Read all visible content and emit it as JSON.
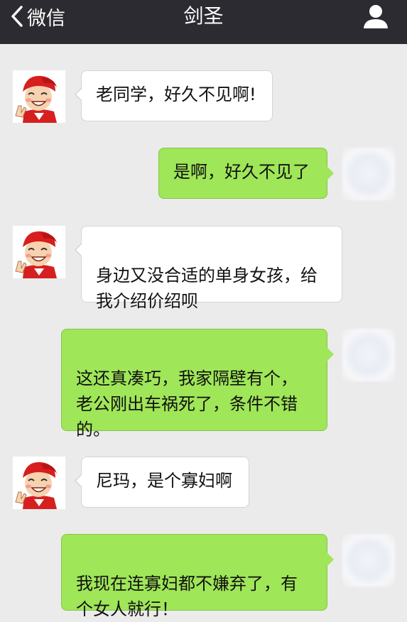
{
  "header": {
    "back_label": "微信",
    "title": "剑圣"
  },
  "messages": [
    {
      "side": "left",
      "text": "老同学，好久不见啊!"
    },
    {
      "side": "right",
      "text": "是啊，好久不见了"
    },
    {
      "side": "left",
      "text": "身边又没合适的单身女孩，给\n我介绍价绍呗"
    },
    {
      "side": "right",
      "text": "这还真凑巧，我家隔壁有个，\n老公刚出车祸死了，条件不错\n的。"
    },
    {
      "side": "left",
      "text": "尼玛，是个寡妇啊"
    },
    {
      "side": "right",
      "text": "我现在连寡妇都不嫌弃了，有\n个女人就行！"
    }
  ],
  "icons": {
    "back": "chevron-left-icon",
    "profile": "person-icon",
    "left_avatar": "cartoon-boy-red-cap-avatar",
    "right_avatar": "blurred-avatar"
  },
  "colors": {
    "topbar": "#2b2b31",
    "background": "#ebebeb",
    "sent_bubble": "#9fe658",
    "received_bubble": "#ffffff"
  }
}
